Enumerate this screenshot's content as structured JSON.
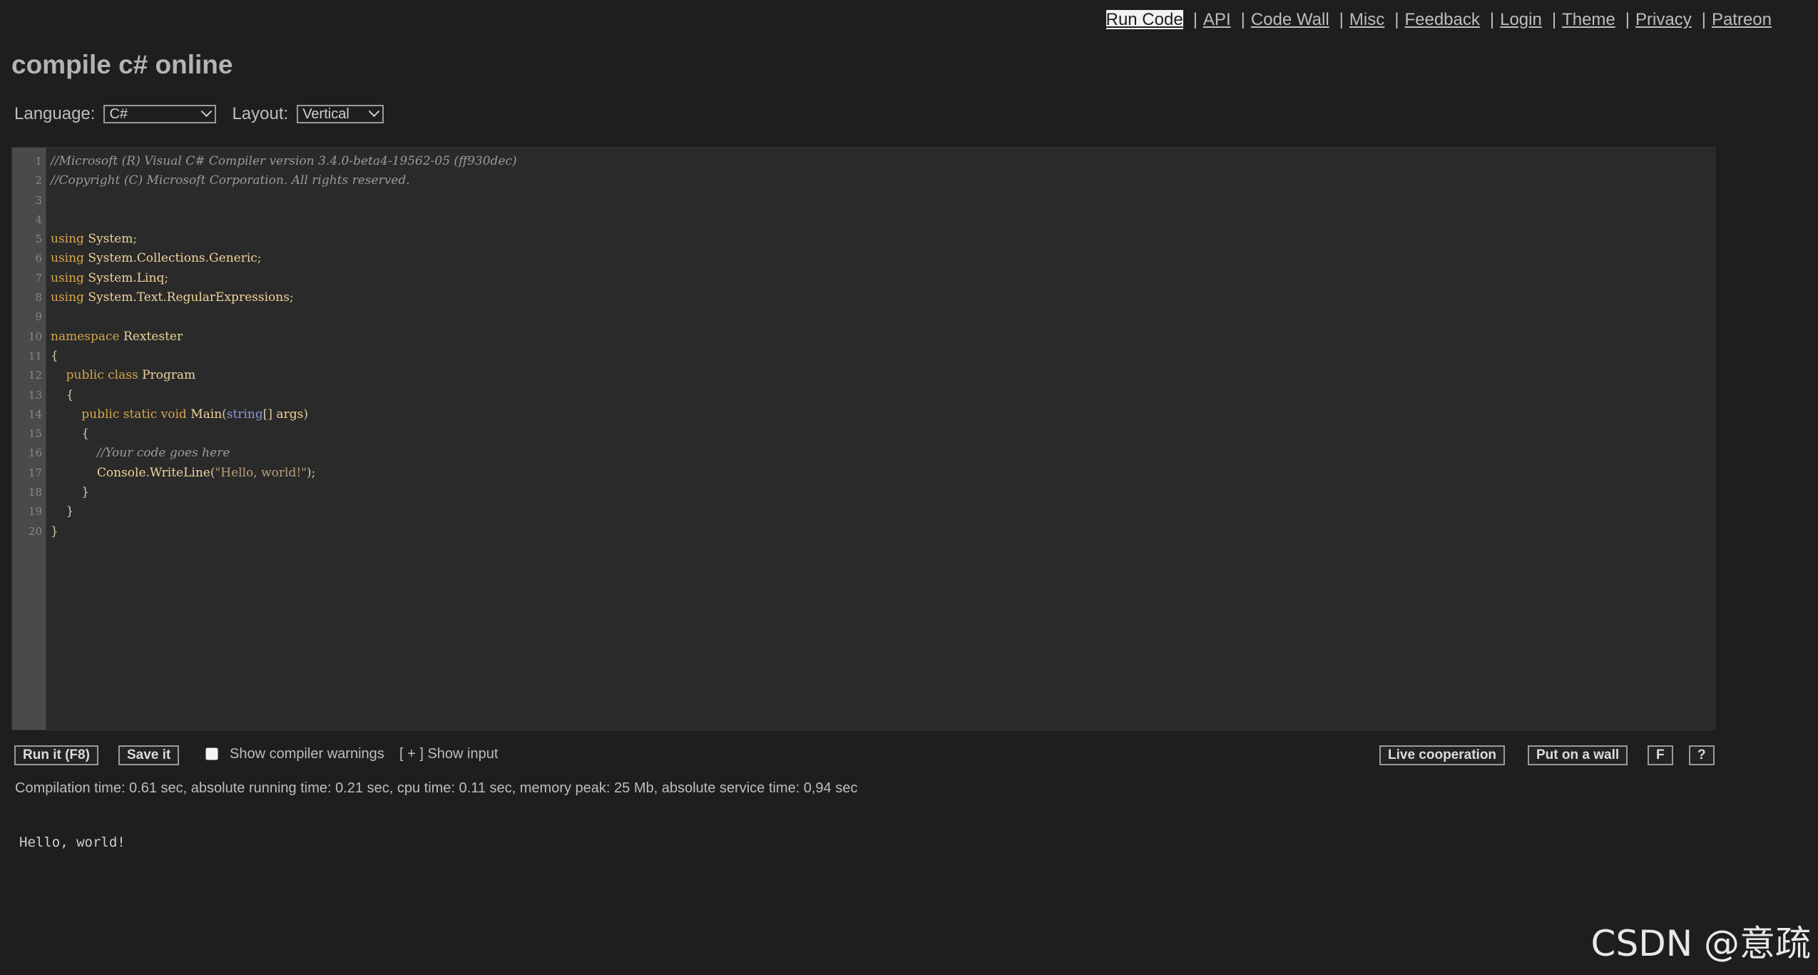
{
  "nav": {
    "items": [
      {
        "label": "Run Code",
        "active": true
      },
      {
        "label": "API"
      },
      {
        "label": "Code Wall"
      },
      {
        "label": "Misc"
      },
      {
        "label": "Feedback"
      },
      {
        "label": "Login"
      },
      {
        "label": "Theme"
      },
      {
        "label": "Privacy"
      },
      {
        "label": "Patreon"
      }
    ],
    "separator": "|"
  },
  "page_title": "compile c# online",
  "controls": {
    "language_label": "Language:",
    "language_value": "C#",
    "layout_label": "Layout:",
    "layout_value": "Vertical"
  },
  "editor": {
    "line_numbers": [
      "1",
      "2",
      "3",
      "4",
      "5",
      "6",
      "7",
      "8",
      "9",
      "10",
      "11",
      "12",
      "13",
      "14",
      "15",
      "16",
      "17",
      "18",
      "19",
      "20"
    ],
    "lines": [
      "//Microsoft (R) Visual C# Compiler version 3.4.0-beta4-19562-05 (ff930dec)",
      "//Copyright (C) Microsoft Corporation. All rights reserved.",
      "",
      "",
      "using System;",
      "using System.Collections.Generic;",
      "using System.Linq;",
      "using System.Text.RegularExpressions;",
      "",
      "namespace Rextester",
      "{",
      "    public class Program",
      "    {",
      "        public static void Main(string[] args)",
      "        {",
      "            //Your code goes here",
      "            Console.WriteLine(\"Hello, world!\");",
      "        }",
      "    }",
      "}"
    ]
  },
  "toolbar": {
    "run_label": "Run it (F8)",
    "save_label": "Save it",
    "show_warnings_label": "Show compiler warnings",
    "show_input_label": "[ + ] Show input",
    "live_coop_label": "Live cooperation",
    "put_on_wall_label": "Put on a wall",
    "f_label": "F",
    "help_label": "?"
  },
  "stats_text": "Compilation time: 0.61 sec, absolute running time: 0.21 sec, cpu time: 0.11 sec, memory peak: 25 Mb, absolute service time: 0,94 sec",
  "output_text": "Hello, world!",
  "watermark": "CSDN @意疏"
}
